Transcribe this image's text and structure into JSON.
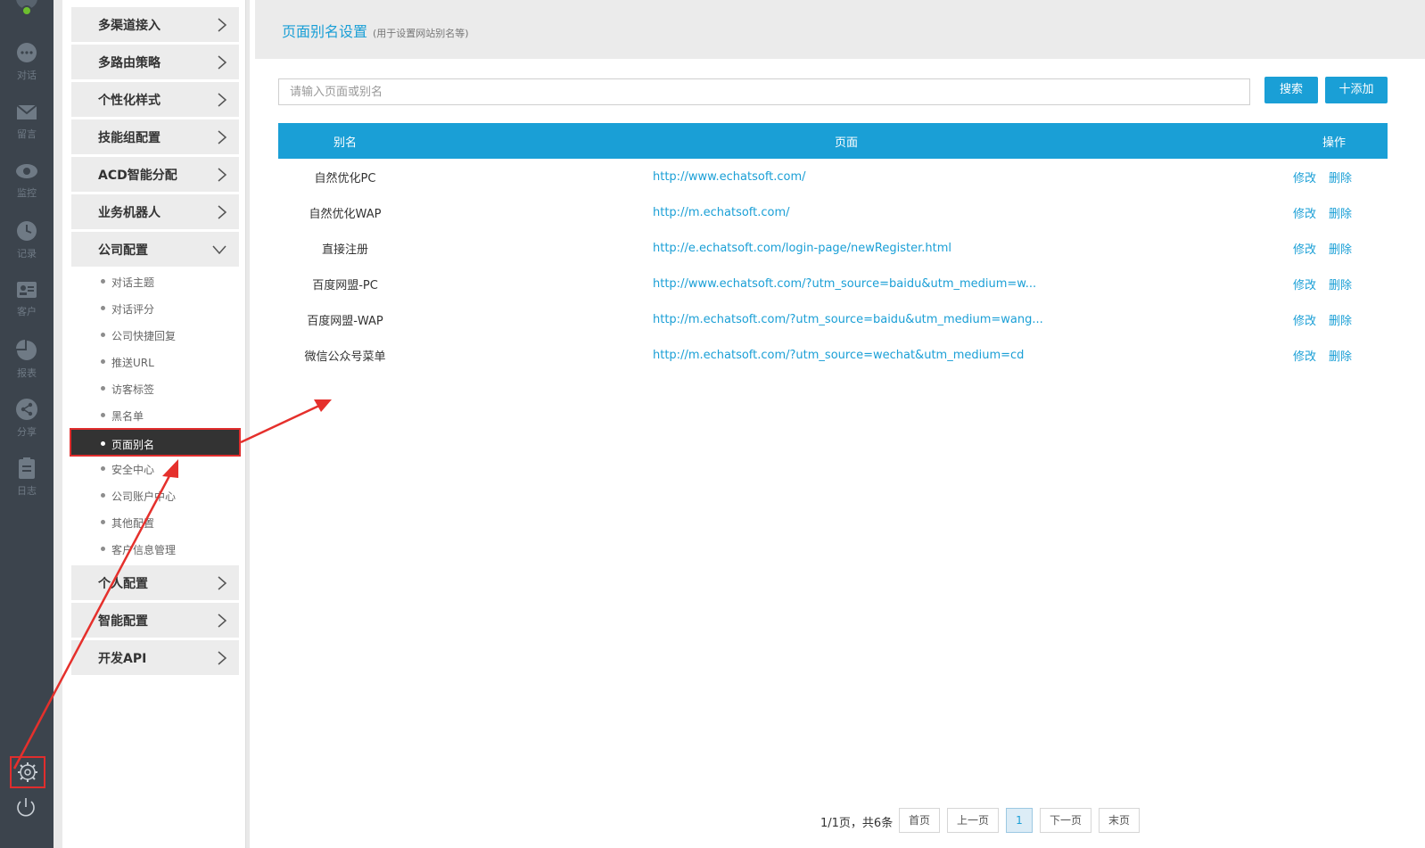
{
  "rail": {
    "items": [
      {
        "label": "对话",
        "icon": "chat-bubble-icon"
      },
      {
        "label": "留言",
        "icon": "envelope-icon"
      },
      {
        "label": "监控",
        "icon": "eye-icon"
      },
      {
        "label": "记录",
        "icon": "clock-icon"
      },
      {
        "label": "客户",
        "icon": "contact-card-icon"
      },
      {
        "label": "报表",
        "icon": "pie-chart-icon"
      },
      {
        "label": "分享",
        "icon": "share-icon"
      },
      {
        "label": "日志",
        "icon": "clipboard-icon"
      }
    ]
  },
  "menu": {
    "groups_top": [
      "多渠道接入",
      "多路由策略",
      "个性化样式",
      "技能组配置",
      "ACD智能分配",
      "业务机器人",
      "公司配置"
    ],
    "sub_items": [
      "对话主题",
      "对话评分",
      "公司快捷回复",
      "推送URL",
      "访客标签",
      "黑名单",
      "页面别名",
      "安全中心",
      "公司账户中心",
      "其他配置",
      "客户信息管理"
    ],
    "active_sub": "页面别名",
    "groups_bottom": [
      "个人配置",
      "智能配置",
      "开发API"
    ]
  },
  "main": {
    "title": "页面别名设置",
    "subtitle": "(用于设置网站别名等)",
    "search_placeholder": "请输入页面或别名",
    "search_button": "搜索",
    "add_button": "十添加",
    "columns": [
      "别名",
      "页面",
      "操作"
    ],
    "rows": [
      {
        "alias": "自然优化PC",
        "page": "http://www.echatsoft.com/"
      },
      {
        "alias": "自然优化WAP",
        "page": "http://m.echatsoft.com/"
      },
      {
        "alias": "直接注册",
        "page": "http://e.echatsoft.com/login-page/newRegister.html"
      },
      {
        "alias": "百度网盟-PC",
        "page": "http://www.echatsoft.com/?utm_source=baidu&utm_medium=w..."
      },
      {
        "alias": "百度网盟-WAP",
        "page": "http://m.echatsoft.com/?utm_source=baidu&utm_medium=wang..."
      },
      {
        "alias": "微信公众号菜单",
        "page": "http://m.echatsoft.com/?utm_source=wechat&utm_medium=cd"
      }
    ],
    "edit_label": "修改",
    "delete_label": "删除",
    "pager": {
      "info": "1/1页，共6条",
      "first": "首页",
      "prev": "上一页",
      "current": "1",
      "next": "下一页",
      "last": "末页"
    }
  }
}
